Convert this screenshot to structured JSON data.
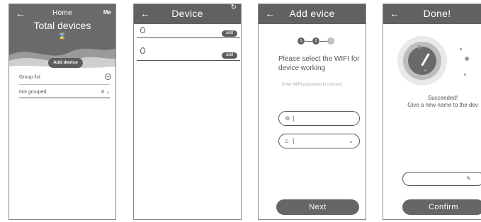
{
  "screen_home": {
    "title": "Home",
    "me_label": "Me",
    "total_devices": "Total devices",
    "hourglass_glyph": "⌛",
    "add_device_button": "Add device",
    "group_list_label": "Group list",
    "not_grouped_label": "Not grouped",
    "not_grouped_count": "8"
  },
  "screen_device": {
    "title": "Device",
    "rows": [
      {
        "add_label": "add"
      },
      {
        "add_label": "add"
      }
    ]
  },
  "screen_add": {
    "title": "Add  evice",
    "steps": [
      "1",
      "2",
      "3"
    ],
    "instruction": "Please select the WIFI for device working",
    "hint": "Enter WIFI password to connect",
    "wifi_value": "",
    "password_value": "",
    "next_button": "Next"
  },
  "screen_done": {
    "title": "Done!",
    "success_line1": "Succeeded!",
    "success_line2": "Give a new name to the dev",
    "name_value": "",
    "confirm_button": "Confirm"
  },
  "icons": {
    "back": "back-arrow-icon",
    "refresh": "refresh-icon",
    "plus": "plus-circle-icon",
    "chevron": "chevron-right-icon",
    "wifi": "wifi-icon",
    "lock": "lock-icon",
    "dropdown": "chevron-down-icon",
    "pencil": "pencil-icon",
    "drop": "water-drop-icon"
  },
  "colors": {
    "header": "#616161",
    "button": "#666666",
    "text": "#555555"
  }
}
